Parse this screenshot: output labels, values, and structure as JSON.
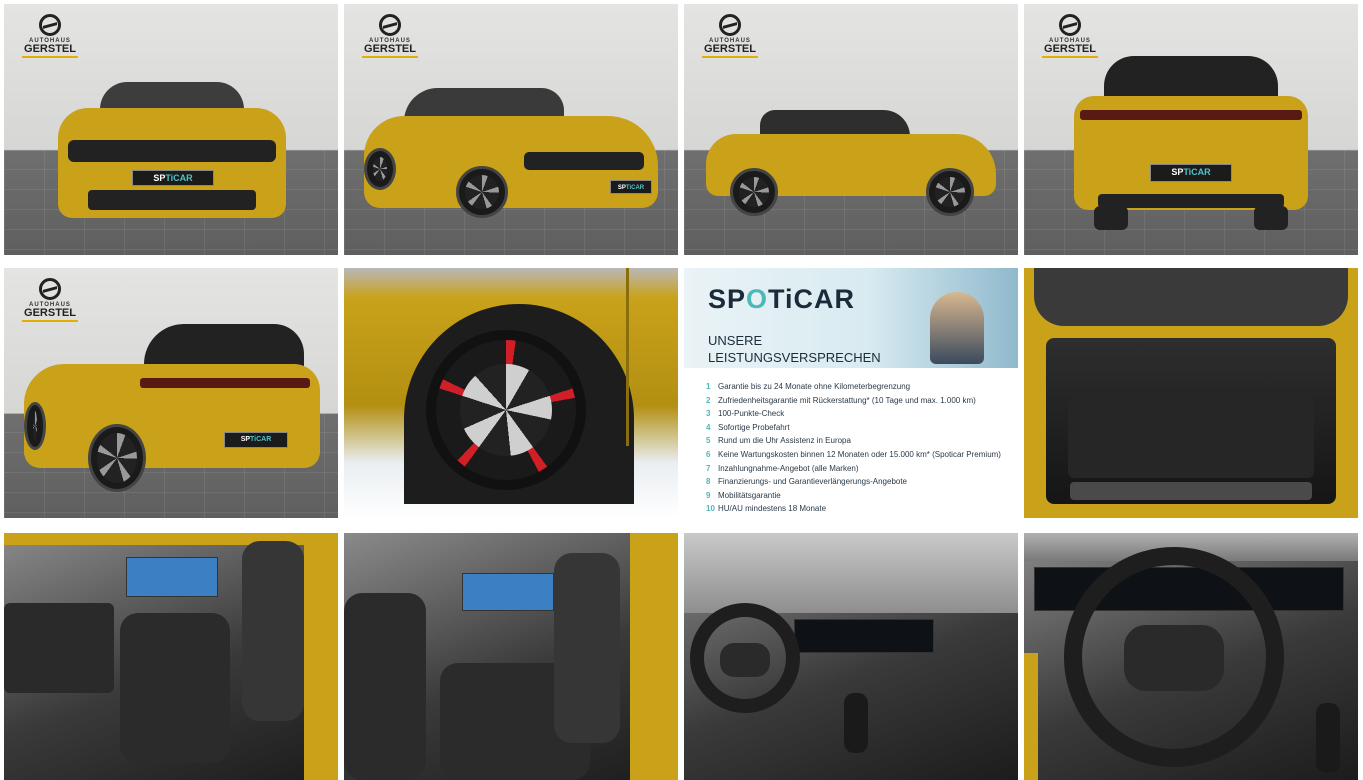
{
  "gallery": {
    "dealer_logo": {
      "line1": "AUTOHAUS",
      "line2": "GERSTEL"
    },
    "plate_text": {
      "a": "SP",
      "b": "TiCAR"
    },
    "photos": [
      {
        "id": "front-view"
      },
      {
        "id": "front-three-quarter-view"
      },
      {
        "id": "side-view"
      },
      {
        "id": "rear-view"
      },
      {
        "id": "rear-three-quarter-view"
      },
      {
        "id": "wheel-closeup"
      },
      {
        "id": "spoticar-promise"
      },
      {
        "id": "trunk-view"
      },
      {
        "id": "front-seats-view"
      },
      {
        "id": "rear-seats-view"
      },
      {
        "id": "dashboard-view"
      },
      {
        "id": "steering-wheel-view"
      }
    ]
  },
  "spoticar": {
    "brand_a": "SP",
    "brand_pin": "O",
    "brand_b": "TiCAR",
    "headline_1": "UNSERE",
    "headline_2": "LEISTUNGSVERSPRECHEN",
    "items": [
      {
        "n": "1",
        "text": "Garantie bis zu 24 Monate ohne Kilometerbegrenzung"
      },
      {
        "n": "2",
        "text": "Zufriedenheitsgarantie mit Rückerstattung* (10 Tage und max. 1.000 km)"
      },
      {
        "n": "3",
        "text": "100-Punkte-Check"
      },
      {
        "n": "4",
        "text": "Sofortige Probefahrt"
      },
      {
        "n": "5",
        "text": "Rund um die Uhr Assistenz in Europa"
      },
      {
        "n": "6",
        "text": "Keine Wartungskosten binnen 12 Monaten oder 15.000 km* (Spoticar Premium)"
      },
      {
        "n": "7",
        "text": "Inzahlungnahme-Angebot (alle Marken)"
      },
      {
        "n": "8",
        "text": "Finanzierungs- und Garantieverlängerungs-Angebote"
      },
      {
        "n": "9",
        "text": "Mobilitätsgarantie"
      },
      {
        "n": "10",
        "text": "HU/AU mindestens 18 Monate"
      }
    ]
  },
  "colors": {
    "car_yellow": "#c9a21a",
    "spoticar_teal": "#4cb8b8",
    "rim_red": "#d21e26"
  }
}
